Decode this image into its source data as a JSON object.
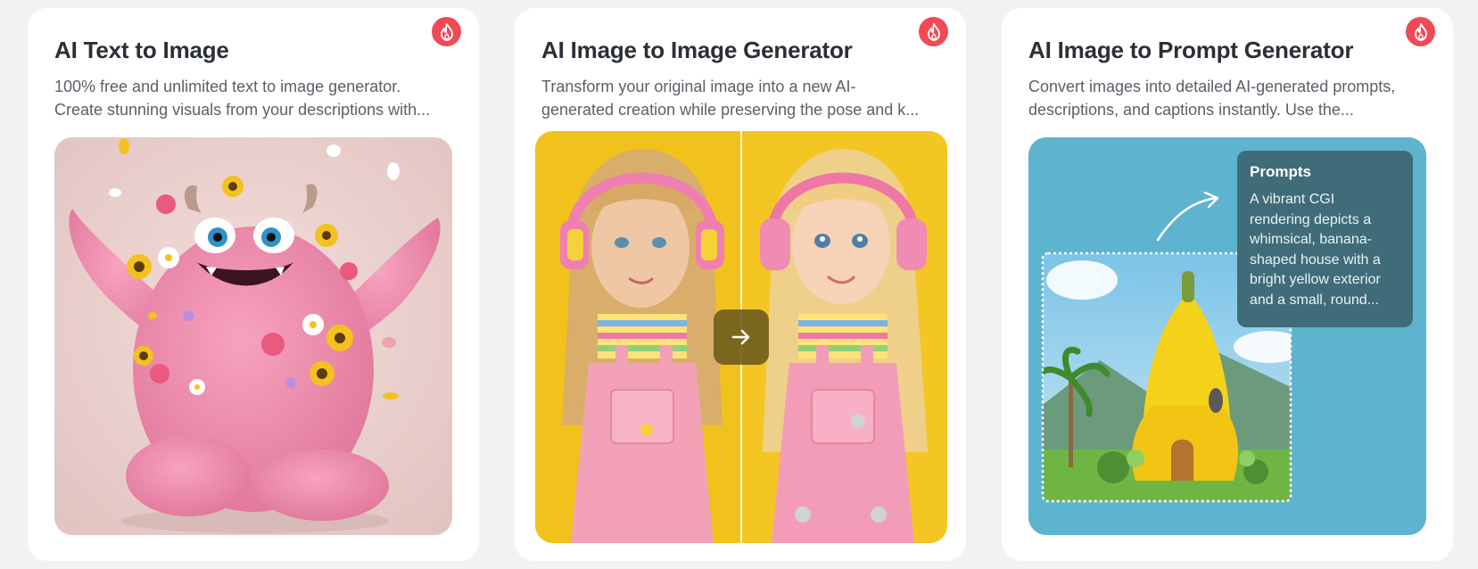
{
  "cards": [
    {
      "title": "AI Text to Image",
      "desc_line1": "100% free and unlimited text to image generator.",
      "desc_line2": "Create stunning visuals from your descriptions with...",
      "badge_icon": "flame-icon"
    },
    {
      "title": "AI Image to Image Generator",
      "desc_line1": "Transform your original image into a new AI-",
      "desc_line2": "generated creation while preserving the pose and k...",
      "badge_icon": "flame-icon",
      "arrow_icon": "arrow-right-icon"
    },
    {
      "title": "AI Image to Prompt Generator",
      "desc_line1": "Convert images into detailed AI-generated prompts,",
      "desc_line2": "descriptions, and captions instantly. Use the...",
      "badge_icon": "flame-icon",
      "prompt": {
        "title": "Prompts",
        "lines": [
          "A vibrant CGI",
          "rendering depicts a",
          "whimsical, banana-",
          "shaped house with a",
          "bright yellow exterior",
          "and a small, round..."
        ]
      }
    }
  ],
  "colors": {
    "page_bg": "#f1f2f4",
    "card_bg": "#ffffff",
    "badge": "#ef4a55",
    "title": "#2b2f36",
    "desc": "#5b6068",
    "prompt_box": "#3f6c78",
    "card3_bg": "#5eb3cf",
    "card2_bg": "#f1c21b",
    "card1_bg": "#ecd1cf"
  }
}
